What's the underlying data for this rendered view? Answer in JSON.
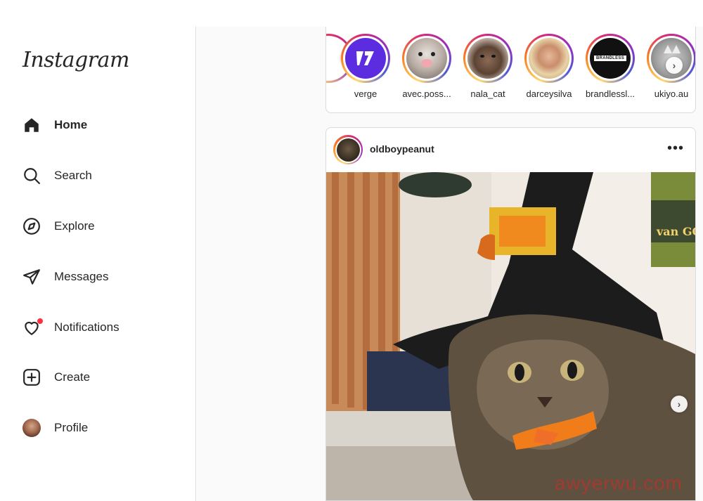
{
  "sidebar": {
    "logo": "Instagram",
    "items": [
      {
        "label": "Home",
        "icon": "home-icon",
        "active": true
      },
      {
        "label": "Search",
        "icon": "search-icon"
      },
      {
        "label": "Explore",
        "icon": "compass-icon"
      },
      {
        "label": "Messages",
        "icon": "paper-plane-icon"
      },
      {
        "label": "Notifications",
        "icon": "heart-icon",
        "badge_color": "#ff3040"
      },
      {
        "label": "Create",
        "icon": "plus-square-icon"
      },
      {
        "label": "Profile",
        "icon": "avatar"
      }
    ]
  },
  "stories": {
    "items": [
      {
        "name": "verge"
      },
      {
        "name": "avec.poss..."
      },
      {
        "name": "nala_cat"
      },
      {
        "name": "darceysilva"
      },
      {
        "name": "brandlessl...",
        "logo_text": "BRANDLESS"
      },
      {
        "name": "ukiyo.au"
      }
    ],
    "prev_icon": "chevron-left-icon",
    "next_icon": "chevron-right-icon"
  },
  "post": {
    "username": "oldboypeanut",
    "more_icon": "more-horizontal-icon",
    "next_icon": "chevron-right-icon",
    "poster_text": "van GOGH",
    "watermark": "awyerwu.com"
  },
  "colors": {
    "accent_gradient": [
      "#feda75",
      "#fa7e1e",
      "#d62976",
      "#962fbf",
      "#4f5bd5"
    ],
    "notification_dot": "#ff3040",
    "verge_purple": "#5b2ce0"
  }
}
